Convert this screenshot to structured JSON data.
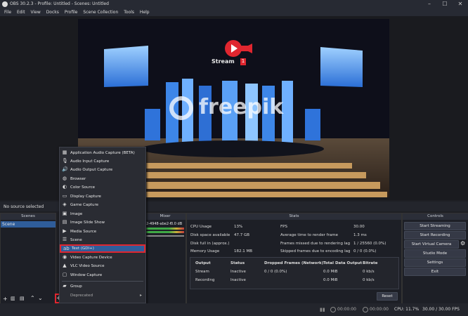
{
  "window": {
    "title": "OBS 30.2.3 - Profile: Untitled - Scenes: Untitled"
  },
  "menubar": [
    "File",
    "Edit",
    "View",
    "Docks",
    "Profile",
    "Scene Collection",
    "Tools",
    "Help"
  ],
  "preview": {
    "logo_text": "Stream",
    "logo_badge": "1",
    "watermark": "freepik"
  },
  "source_bar": {
    "no_source": "No source selected"
  },
  "scenes_dock": {
    "title": "Scenes",
    "items": [
      "Scene"
    ]
  },
  "mixer_dock": {
    "title": "Mixer",
    "device_fragment": "2-4948-abe2-f",
    "db_value": "0.0 dB"
  },
  "context_menu": {
    "items": [
      {
        "label": "Application Audio Capture (BETA)",
        "icon": "app-audio-icon"
      },
      {
        "label": "Audio Input Capture",
        "icon": "microphone-icon"
      },
      {
        "label": "Audio Output Capture",
        "icon": "speaker-icon"
      },
      {
        "label": "Browser",
        "icon": "globe-icon"
      },
      {
        "label": "Color Source",
        "icon": "palette-icon"
      },
      {
        "label": "Display Capture",
        "icon": "monitor-icon"
      },
      {
        "label": "Game Capture",
        "icon": "gamepad-icon"
      },
      {
        "label": "Image",
        "icon": "image-icon"
      },
      {
        "label": "Image Slide Show",
        "icon": "slideshow-icon"
      },
      {
        "label": "Media Source",
        "icon": "play-icon"
      },
      {
        "label": "Scene",
        "icon": "list-icon"
      },
      {
        "label": "Text (GDI+)",
        "icon": "text-icon"
      },
      {
        "label": "Video Capture Device",
        "icon": "camera-icon"
      },
      {
        "label": "VLC Video Source",
        "icon": "vlc-icon"
      },
      {
        "label": "Window Capture",
        "icon": "window-icon"
      },
      {
        "label": "Group",
        "icon": "folder-icon"
      },
      {
        "label": "Deprecated",
        "icon": ""
      }
    ],
    "highlighted": "Text (GDI+)"
  },
  "stats_dock": {
    "title": "Stats",
    "left": [
      {
        "label": "CPU Usage",
        "value": "13%"
      },
      {
        "label": "Disk space available",
        "value": "47.7 GB"
      },
      {
        "label": "Disk full in (approx.)",
        "value": ""
      },
      {
        "label": "Memory Usage",
        "value": "182.1 MB"
      }
    ],
    "right": [
      {
        "label": "FPS",
        "value": "30.00"
      },
      {
        "label": "Average time to render frame",
        "value": "1.3 ms"
      },
      {
        "label": "Frames missed due to rendering lag",
        "value": "1 / 25560 (0.0%)"
      },
      {
        "label": "Skipped frames due to encoding lag",
        "value": "0 / 0 (0.0%)"
      }
    ],
    "table": {
      "headers": [
        "Output",
        "Status",
        "Dropped Frames (Network)",
        "Total Data Output",
        "Bitrate"
      ],
      "rows": [
        [
          "Stream",
          "Inactive",
          "0 / 0 (0.0%)",
          "0.0 MiB",
          "0 kb/s"
        ],
        [
          "Recording",
          "Inactive",
          "",
          "0.0 MiB",
          "0 kb/s"
        ]
      ]
    },
    "reset": "Reset"
  },
  "controls_dock": {
    "title": "Controls",
    "buttons": [
      "Start Streaming",
      "Start Recording",
      "Start Virtual Camera",
      "Studio Mode",
      "Settings",
      "Exit"
    ]
  },
  "status_bar": {
    "stream_time": "00:00:00",
    "rec_time": "00:00:00",
    "cpu": "CPU: 11.7%",
    "fps": "30.00 / 30.00 FPS"
  },
  "colors": {
    "accent_red": "#e0262f",
    "highlight": "#2f5d9a"
  }
}
